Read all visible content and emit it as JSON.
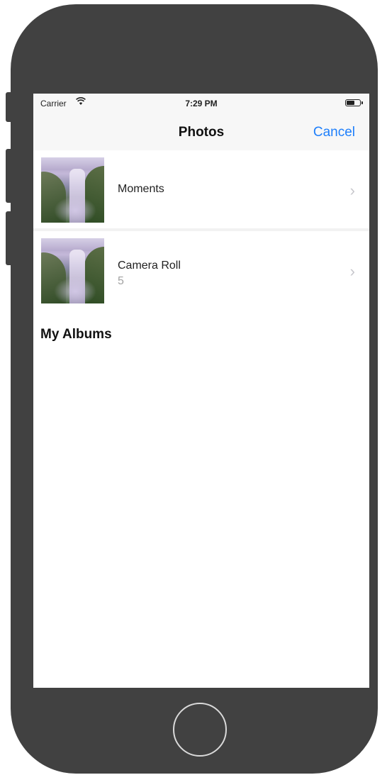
{
  "status_bar": {
    "carrier": "Carrier",
    "wifi_icon": "wifi-icon",
    "time": "7:29 PM",
    "battery_icon": "battery-icon"
  },
  "nav_bar": {
    "title": "Photos",
    "cancel_label": "Cancel",
    "accent_color": "#1e7ffb"
  },
  "albums": [
    {
      "title": "Moments",
      "count": ""
    },
    {
      "title": "Camera Roll",
      "count": "5"
    }
  ],
  "section_header": "My Albums",
  "colors": {
    "device_body": "#414141",
    "screen_bg": "#ffffff",
    "bar_bg": "#f7f7f7"
  }
}
